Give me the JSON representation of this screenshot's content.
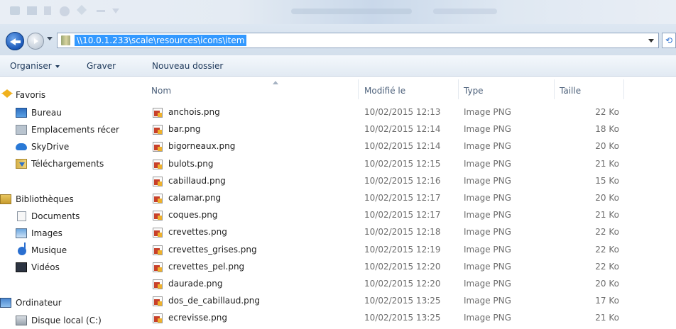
{
  "window": {
    "address": "\\\\10.0.1.233\\scale\\resources\\icons\\item"
  },
  "toolbar": {
    "organiser": "Organiser",
    "graver": "Graver",
    "nouveau_dossier": "Nouveau dossier"
  },
  "sidebar": {
    "favoris": {
      "label": "Favoris",
      "items": [
        "Bureau",
        "Emplacements récer",
        "SkyDrive",
        "Téléchargements"
      ]
    },
    "bibliotheques": {
      "label": "Bibliothèques",
      "items": [
        "Documents",
        "Images",
        "Musique",
        "Vidéos"
      ]
    },
    "ordinateur": {
      "label": "Ordinateur",
      "items": [
        "Disque local (C:)"
      ]
    }
  },
  "columns": {
    "name": "Nom",
    "modified": "Modifié le",
    "type": "Type",
    "size": "Taille"
  },
  "files": [
    {
      "name": "anchois.png",
      "modified": "10/02/2015 12:13",
      "type": "Image PNG",
      "size": "22 Ko"
    },
    {
      "name": "bar.png",
      "modified": "10/02/2015 12:14",
      "type": "Image PNG",
      "size": "18 Ko"
    },
    {
      "name": "bigorneaux.png",
      "modified": "10/02/2015 12:14",
      "type": "Image PNG",
      "size": "20 Ko"
    },
    {
      "name": "bulots.png",
      "modified": "10/02/2015 12:15",
      "type": "Image PNG",
      "size": "21 Ko"
    },
    {
      "name": "cabillaud.png",
      "modified": "10/02/2015 12:16",
      "type": "Image PNG",
      "size": "15 Ko"
    },
    {
      "name": "calamar.png",
      "modified": "10/02/2015 12:17",
      "type": "Image PNG",
      "size": "20 Ko"
    },
    {
      "name": "coques.png",
      "modified": "10/02/2015 12:17",
      "type": "Image PNG",
      "size": "21 Ko"
    },
    {
      "name": "crevettes.png",
      "modified": "10/02/2015 12:18",
      "type": "Image PNG",
      "size": "22 Ko"
    },
    {
      "name": "crevettes_grises.png",
      "modified": "10/02/2015 12:19",
      "type": "Image PNG",
      "size": "22 Ko"
    },
    {
      "name": "crevettes_pel.png",
      "modified": "10/02/2015 12:20",
      "type": "Image PNG",
      "size": "22 Ko"
    },
    {
      "name": "daurade.png",
      "modified": "10/02/2015 12:20",
      "type": "Image PNG",
      "size": "20 Ko"
    },
    {
      "name": "dos_de_cabillaud.png",
      "modified": "10/02/2015 13:25",
      "type": "Image PNG",
      "size": "17 Ko"
    },
    {
      "name": "ecrevisse.png",
      "modified": "10/02/2015 13:25",
      "type": "Image PNG",
      "size": "21 Ko"
    }
  ]
}
